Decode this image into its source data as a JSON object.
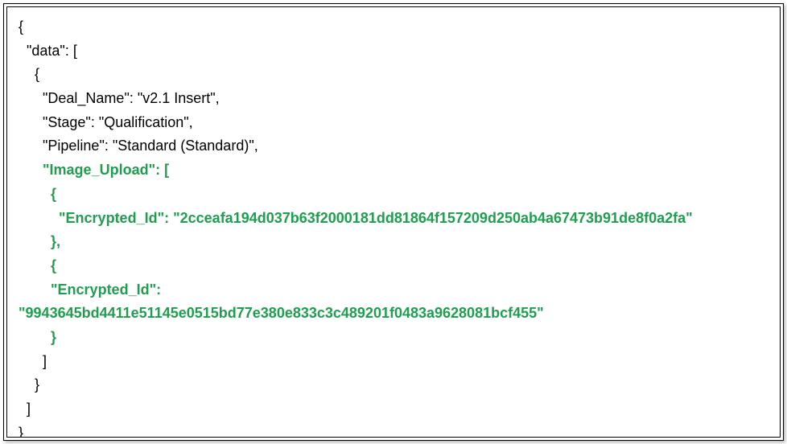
{
  "code": {
    "line1": "{",
    "line2": "  \"data\": [",
    "line3": "    {",
    "line4": "      \"Deal_Name\": \"v2.1 Insert\",",
    "line5": "      \"Stage\": \"Qualification\",",
    "line6": "      \"Pipeline\": \"Standard (Standard)\",",
    "line7": "      \"Image_Upload\": [",
    "line8": "        {",
    "line9": "          \"Encrypted_Id\": \"2cceafa194d037b63f2000181dd81864f157209d250ab4a67473b91de8f0a2fa\"",
    "line10": "        },",
    "line11": "        {",
    "line12": "        \"Encrypted_Id\":",
    "line13": "\"9943645bd4411e51145e0515bd77e380e833c3c489201f0483a9628081bcf455\"",
    "line14": "        }",
    "line15": "      ]",
    "line16": "    }",
    "line17": "  ]",
    "line18": "}"
  }
}
